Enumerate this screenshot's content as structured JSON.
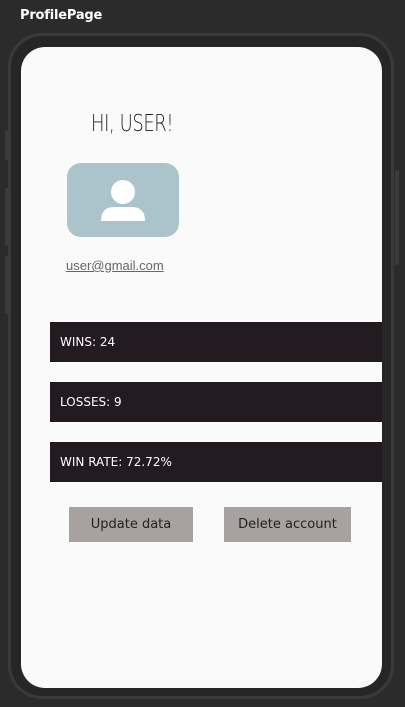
{
  "window": {
    "title": "ProfilePage"
  },
  "profile": {
    "greeting": "HI, USER!",
    "avatar_icon": "user-icon",
    "email": "user@gmail.com"
  },
  "stats": {
    "wins": "WINS: 24",
    "losses": "LOSSES: 9",
    "win_rate": "WIN RATE: 72.72%"
  },
  "actions": {
    "update_label": "Update data",
    "delete_label": "Delete account"
  },
  "colors": {
    "screen_bg": "#fafafa",
    "stat_bar_bg": "#231b20",
    "avatar_bg": "#abc4cc",
    "button_bg": "#a7a19f"
  }
}
